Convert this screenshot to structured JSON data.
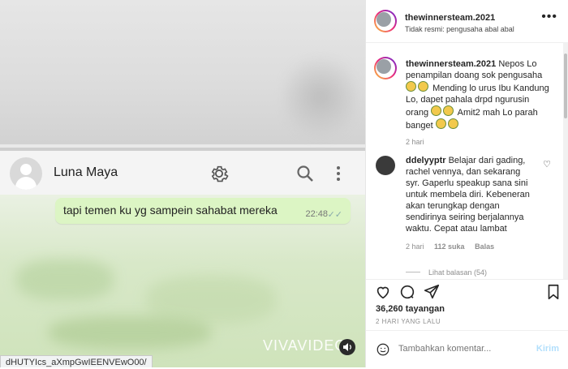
{
  "post_header": {
    "username": "thewinnersteam.2021",
    "subtitle": "Tidak resmi: pengusaha abal abal",
    "more_icon": "more-horizontal-icon"
  },
  "video": {
    "contact_name": "Luna Maya",
    "message_text": "tapi temen ku yg sampein sahabat mereka",
    "message_time": "22:48",
    "watermark": "VIVAVIDEO",
    "url_text": "dHUTYIcs_aXmpGwIEENVEwO00/",
    "icons": [
      "avatar-placeholder-icon",
      "gear-icon",
      "search-icon",
      "kebab-menu-icon",
      "double-check-icon",
      "volume-icon"
    ]
  },
  "caption": {
    "username": "thewinnersteam.2021",
    "text_1": "Nepos Lo penampilan doang sok pengusaha",
    "text_2": "Mending lo urus Ibu Kandung Lo, dapet pahala drpd ngurusin orang",
    "text_3": "Amit2 mah Lo parah banget",
    "time": "2 hari"
  },
  "comment": {
    "username": "ddelyyptr",
    "text": "Belajar dari gading, rachel vennya, dan sekarang syr. Gaperlu speakup sana sini untuk membela diri. Kebeneran akan terungkap dengan sendirinya seiring berjalannya waktu. Cepat atau lambat",
    "time": "2 hari",
    "likes": "112 suka",
    "reply": "Balas",
    "view_replies": "Lihat balasan (54)"
  },
  "actions": {
    "views": "36,260 tayangan",
    "posted": "2 HARI YANG LALU",
    "icons": [
      "heart-icon",
      "comment-icon",
      "share-icon",
      "bookmark-icon"
    ]
  },
  "add_comment": {
    "placeholder": "Tambahkan komentar...",
    "send_label": "Kirim"
  },
  "colors": {
    "bubble": "#dcf5c4",
    "chat_bg": "#d8e8c8",
    "send_disabled": "#b2dffc",
    "text_primary": "#262626",
    "text_muted": "#8e8e8e"
  }
}
